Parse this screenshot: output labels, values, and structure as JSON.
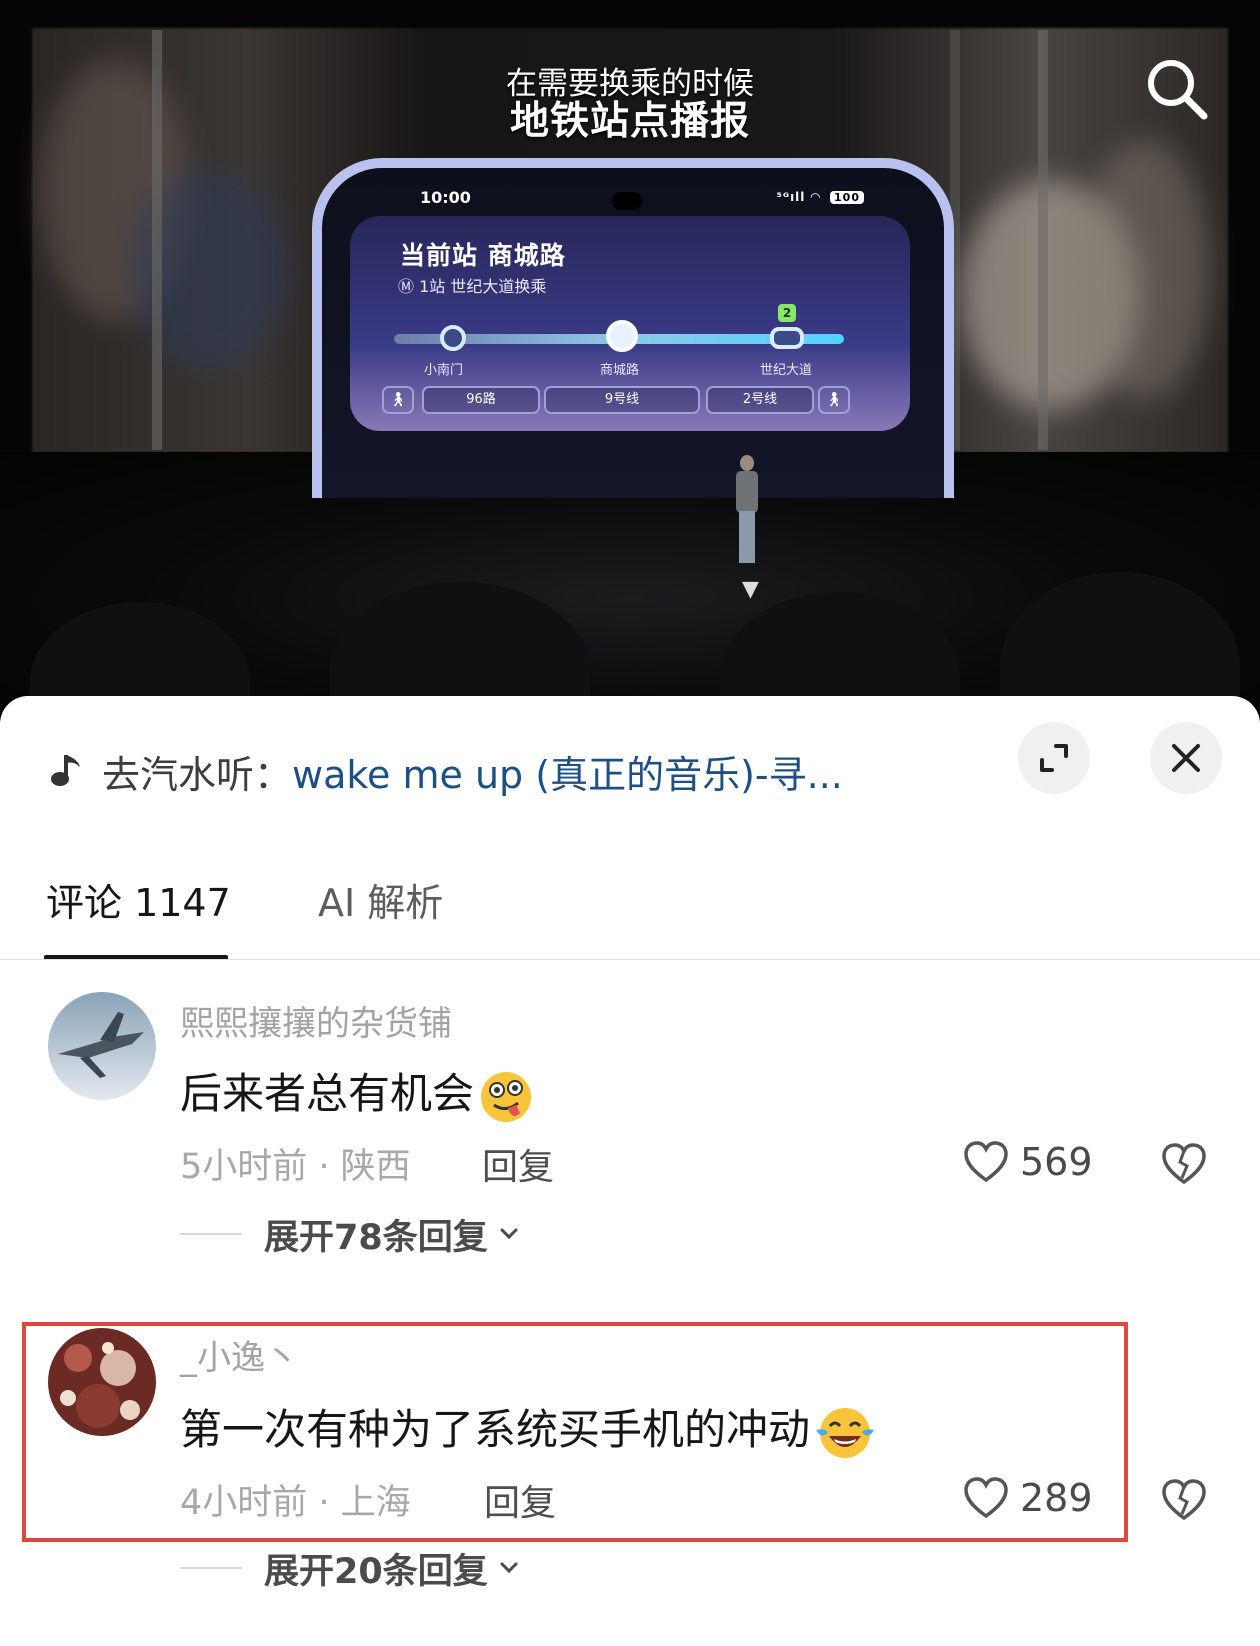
{
  "video": {
    "caption_line1": "在需要换乘的时候",
    "caption_line2": "地铁站点播报",
    "search_icon": "search-icon",
    "phone": {
      "time": "10:00",
      "battery": "100",
      "current_station": "当前站 商城路",
      "transfer_info": "1站 世纪大道换乘",
      "stations": [
        "小南门",
        "商城路",
        "世纪大道"
      ],
      "transfer_badge": "2",
      "chips": [
        "96路",
        "9号线",
        "2号线"
      ]
    }
  },
  "panel": {
    "music_icon": "music-note-icon",
    "music_prefix": "去汽水听：",
    "music_title": "wake me up (真正的音乐)-寻...",
    "expand_icon": "expand-icon",
    "close_icon": "close-icon",
    "tabs": [
      {
        "label": "评论 1147",
        "active": true
      },
      {
        "label": "AI 解析",
        "active": false
      }
    ],
    "comments": [
      {
        "username": "熙熙攘攘的杂货铺",
        "text": "后来者总有机会",
        "emoji": "tongue-out-emoji",
        "meta": "5小时前 · 陕西",
        "reply_label": "回复",
        "likes": "569",
        "expand_label": "展开78条回复",
        "highlighted": false
      },
      {
        "username": "_小逸丶",
        "text": "第一次有种为了系统买手机的冲动",
        "emoji": "tears-of-joy-emoji",
        "meta": "4小时前 · 上海",
        "reply_label": "回复",
        "likes": "289",
        "expand_label": "展开20条回复",
        "highlighted": true
      }
    ],
    "colors": {
      "highlight_border": "#e0473f",
      "link": "#1e4f84",
      "muted_text": "#a3a3a3"
    }
  }
}
